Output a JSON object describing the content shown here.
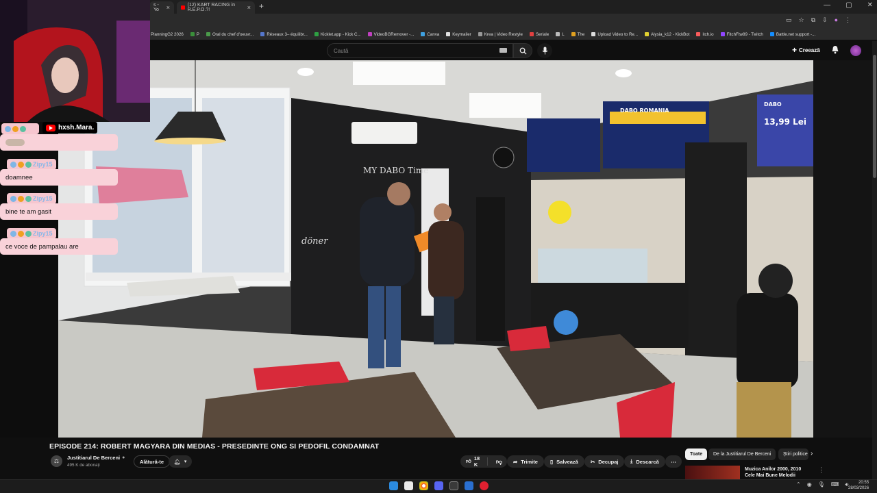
{
  "browser": {
    "tabs": [
      {
        "label": "s - Yo"
      },
      {
        "label": "(12) KART RACING in R.E.P.O.?!"
      }
    ],
    "bookmarks": [
      "PlanningG2 2026",
      "P",
      "Oral du chef d'oeuvr...",
      "Réseaux 3– équilibr...",
      "Kicklet.app - Kick C...",
      "VideoBGRemover -...",
      "Canva",
      "Keymailer",
      "Krea | Video Restyle",
      "Seriale",
      "L",
      "The",
      "Upload Video to Re...",
      "Alysia_k12 - KickBot",
      "itch.io",
      "FitchFtw89 - Twitch",
      "Battle.net support -..."
    ]
  },
  "header": {
    "search_placeholder": "Caută",
    "create_label": "Creează"
  },
  "stream_overlay": {
    "channel_badge": "hxsh.Mara.",
    "chat": [
      {
        "user": "",
        "message": ""
      },
      {
        "user": "Zipy15",
        "message": "doamnee"
      },
      {
        "user": "Zipy15",
        "message": "bine te am gasit"
      },
      {
        "user": "Zipy15",
        "message": "ce voce de pampalau are"
      }
    ]
  },
  "video": {
    "title": "EPISODE 214: ROBERT MAGYARA DIN MEDIAS - PRESEDINTE ONG SI PEDOFIL CONDAMNAT",
    "channel": "Justitiarul De Berceni",
    "subscribers": "495 K de abonați",
    "join_label": "Alătură-te",
    "likes": "18 K",
    "share_label": "Trimite",
    "save_label": "Salvează",
    "clip_label": "Decupaj",
    "download_label": "Descarcă",
    "scene_text": {
      "dabo_price": "13,99 Lei",
      "dabo_brand": "DABO",
      "menu_brand": "DABO ROMANIA",
      "wall_text": "MY DABO Time",
      "doner": "döner"
    }
  },
  "related": {
    "chips": [
      "Toate",
      "De la Justitiarul De Berceni",
      "Știri politice"
    ],
    "first_title": "Muzica Anilor 2000, 2010",
    "first_subtitle": "Cele Mai Bune Melodii"
  },
  "taskbar": {
    "time": "20:55",
    "date": "28/03/2026"
  },
  "colors": {
    "youtube_bg": "#0f0f0f",
    "chat_bubble": "#f9d2d9",
    "chat_username": "#8ab8e8",
    "youtube_red": "#ff0000"
  }
}
